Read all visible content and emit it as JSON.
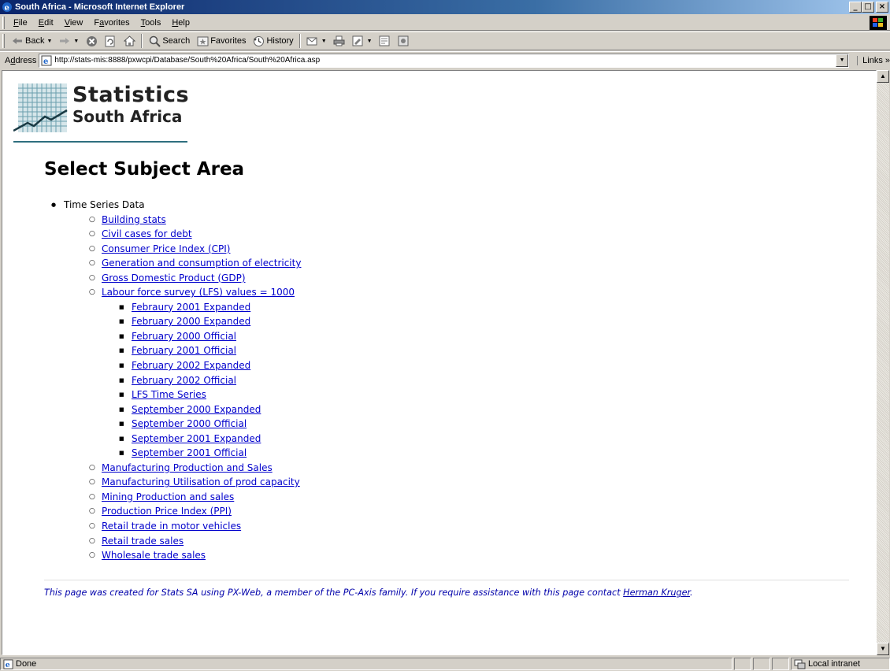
{
  "window": {
    "title": "South Africa - Microsoft Internet Explorer"
  },
  "menu": [
    {
      "pre": "",
      "u": "F",
      "post": "ile"
    },
    {
      "pre": "",
      "u": "E",
      "post": "dit"
    },
    {
      "pre": "",
      "u": "V",
      "post": "iew"
    },
    {
      "pre": "F",
      "u": "a",
      "post": "vorites"
    },
    {
      "pre": "",
      "u": "T",
      "post": "ools"
    },
    {
      "pre": "",
      "u": "H",
      "post": "elp"
    }
  ],
  "toolbar": {
    "back_label": "Back",
    "search_label": "Search",
    "favorites_label": "Favorites",
    "history_label": "History"
  },
  "address": {
    "label_pre": "A",
    "label_u": "d",
    "label_post": "dress",
    "url": "http://stats-mis:8888/pxwcpi/Database/South%20Africa/South%20Africa.asp",
    "links_label": "Links »"
  },
  "logo": {
    "line1": "Statistics",
    "line2": "South Africa"
  },
  "page": {
    "heading": "Select Subject Area",
    "root_item": "Time Series Data",
    "subjects_before": [
      "Building stats",
      "Civil cases for debt",
      "Consumer Price Index (CPI)",
      "Generation and consumption of electricity",
      "Gross Domestic Product (GDP)",
      "Labour force survey (LFS) values = 1000"
    ],
    "lfs_items": [
      "Febraury 2001 Expanded",
      "February 2000 Expanded",
      "February 2000 Official",
      "February 2001 Official",
      "February 2002 Expanded",
      "February 2002 Official",
      "LFS Time Series",
      "September 2000 Expanded",
      "September 2000 Official",
      "September 2001 Expanded",
      "September 2001 Official"
    ],
    "subjects_after": [
      "Manufacturing Production and Sales",
      "Manufacturing Utilisation of prod capacity",
      "Mining Production and sales",
      "Production Price Index (PPI)",
      "Retail trade in motor vehicles",
      "Retail trade sales",
      "Wholesale trade sales"
    ],
    "footer_text": "This page was created for Stats SA using PX-Web, a member of the PC-Axis family. If you require assistance with this page contact ",
    "footer_link": "Herman Kruger",
    "footer_end": "."
  },
  "status": {
    "text": "Done",
    "zone": "Local intranet"
  },
  "colors": {
    "title_bar": "#0a246a",
    "link": "#0000cc",
    "footer_text": "#0000aa",
    "logo_rule": "#2f6f7f"
  },
  "icons": [
    "ie-icon",
    "windows-logo-icon",
    "back-arrow-icon",
    "forward-arrow-icon",
    "stop-icon",
    "refresh-icon",
    "home-icon",
    "search-icon",
    "favorites-icon",
    "history-icon",
    "mail-icon",
    "print-icon",
    "edit-icon",
    "discuss-icon",
    "messenger-icon"
  ]
}
